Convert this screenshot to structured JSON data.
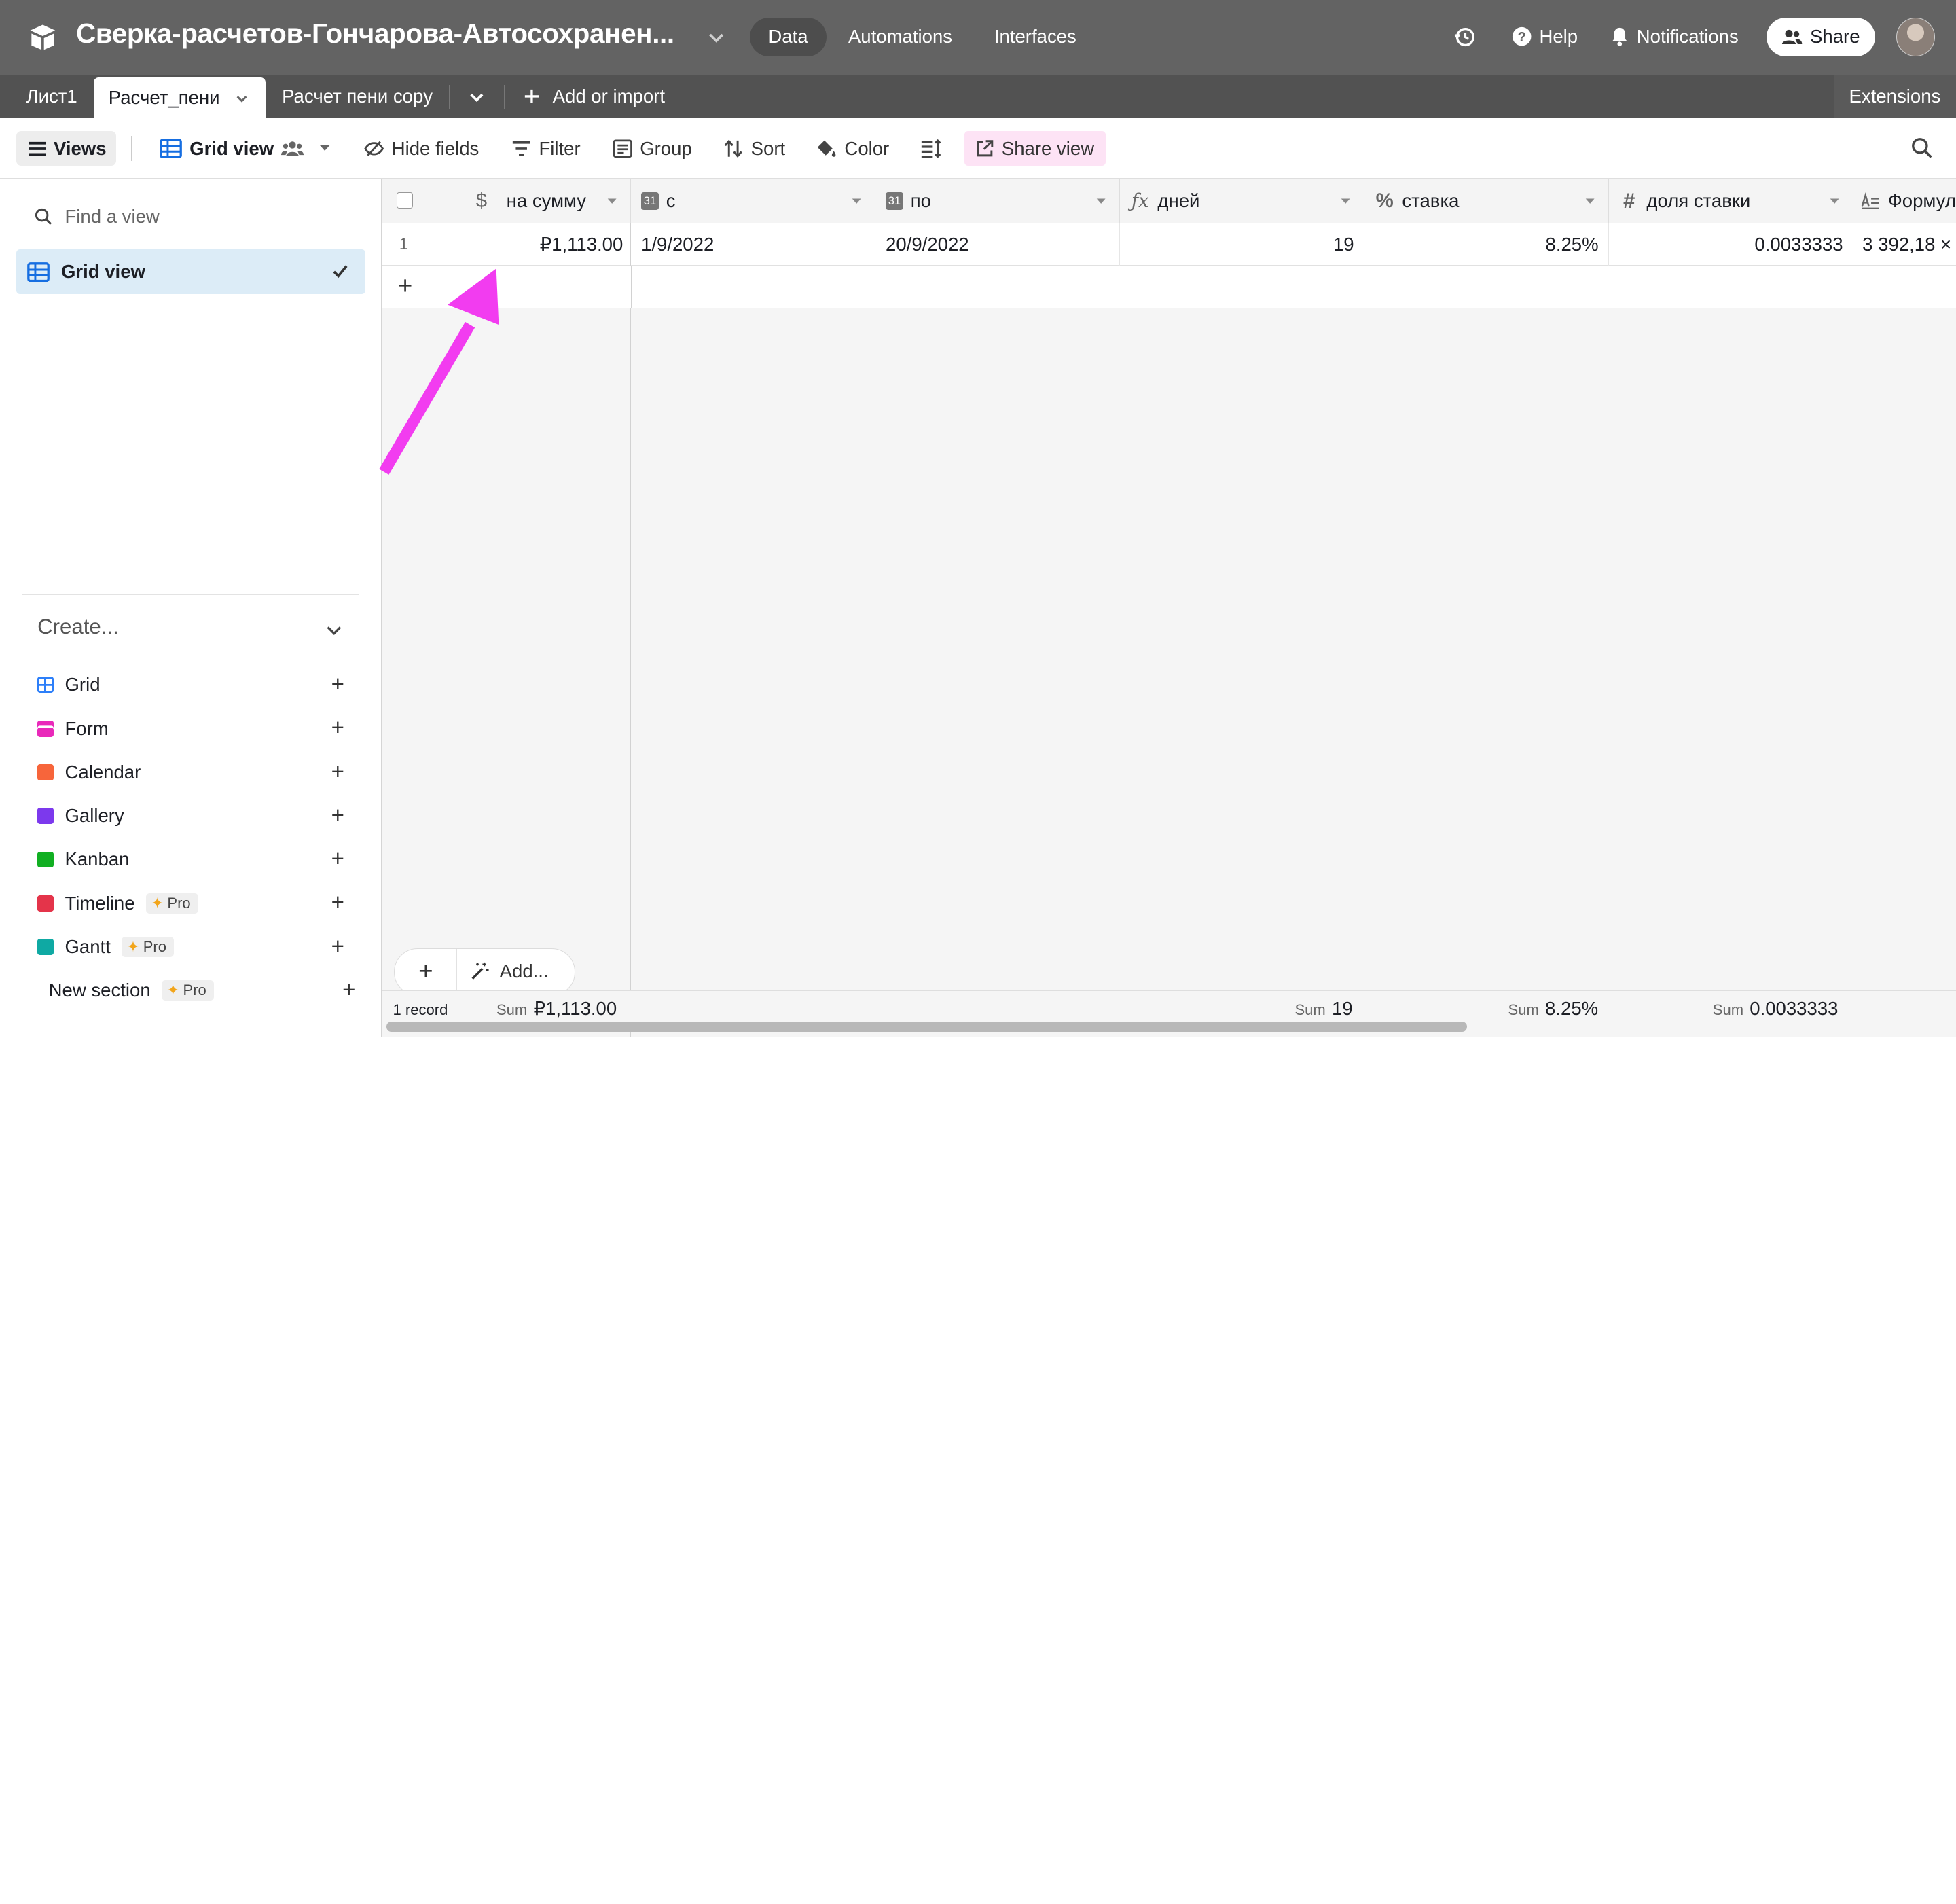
{
  "header": {
    "base_title": "Сверка-расчетов-Гончарова-Автосохранен...",
    "nav": [
      "Data",
      "Automations",
      "Interfaces"
    ],
    "help": "Help",
    "notifications": "Notifications",
    "share": "Share"
  },
  "tabs": {
    "items": [
      "Лист1",
      "Расчет_пени",
      "Расчет пени copy"
    ],
    "add_or_import": "Add or import",
    "extensions": "Extensions"
  },
  "toolbar": {
    "views": "Views",
    "grid_view": "Grid view",
    "hide_fields": "Hide fields",
    "filter": "Filter",
    "group": "Group",
    "sort": "Sort",
    "color": "Color",
    "share_view": "Share view"
  },
  "sidebar": {
    "find_placeholder": "Find a view",
    "active_view": "Grid view",
    "create_label": "Create...",
    "create_items": [
      {
        "label": "Grid",
        "color": "#2d7ff9",
        "pro": ""
      },
      {
        "label": "Form",
        "color": "#e929ba",
        "pro": ""
      },
      {
        "label": "Calendar",
        "color": "#f7653b",
        "pro": ""
      },
      {
        "label": "Gallery",
        "color": "#7c39ed",
        "pro": ""
      },
      {
        "label": "Kanban",
        "color": "#11af22",
        "pro": ""
      },
      {
        "label": "Timeline",
        "color": "#e4344a",
        "pro": "Pro"
      },
      {
        "label": "Gantt",
        "color": "#0fa9a3",
        "pro": "Pro"
      }
    ],
    "new_section": "New section",
    "new_section_pro": "Pro"
  },
  "grid": {
    "columns": [
      "на сумму",
      "с",
      "по",
      "дней",
      "ставка",
      "доля ставки",
      "Формул"
    ],
    "rows": [
      {
        "num": "1",
        "cells": [
          "₽1,113.00",
          "1/9/2022",
          "20/9/2022",
          "19",
          "8.25%",
          "0.0033333",
          "3 392,18 ×"
        ]
      }
    ],
    "add_row": "+",
    "add_label": "Add...",
    "record_count": "1 record",
    "sum_label": "Sum",
    "sums": {
      "amount": "₽1,113.00",
      "days": "19",
      "rate": "8.25%",
      "share": "0.0033333"
    }
  }
}
